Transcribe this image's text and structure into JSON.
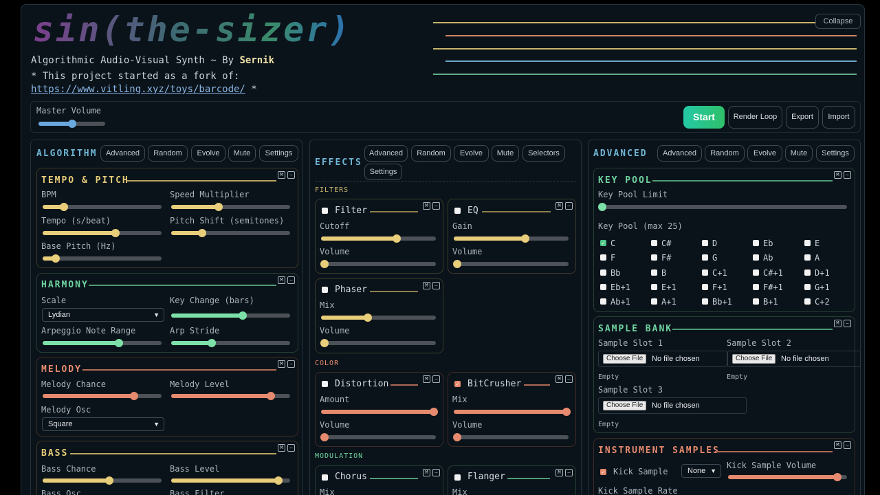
{
  "header": {
    "title": "sin(the-sizer)",
    "tagline": "Algorithmic Audio-Visual Synth ~ By ",
    "author": "Sernik",
    "fork_line": "* This project started as a fork of:",
    "fork_url": "https://www.vitling.xyz/toys/barcode/",
    "fork_suffix": " *",
    "collapse": "Collapse"
  },
  "visual_lines": [
    "#c8b56a",
    "#d08466",
    "#c8b56a",
    "#6fa6c8",
    "#5fb08a"
  ],
  "master": {
    "label": "Master Volume",
    "value": 0.5
  },
  "toolbar": {
    "start": "Start",
    "render_loop": "Render Loop",
    "export": "Export",
    "import": "Import"
  },
  "algorithm": {
    "title": "ALGORITHM",
    "buttons": [
      "Advanced",
      "Random",
      "Evolve",
      "Mute",
      "Settings"
    ],
    "tempo": {
      "title": "TEMPO & PITCH",
      "bpm": "BPM",
      "speed": "Speed Multiplier",
      "tempo": "Tempo (s/beat)",
      "pitch_shift": "Pitch Shift (semitones)",
      "base_pitch": "Base Pitch (Hz)",
      "values": {
        "bpm": 0.18,
        "speed": 0.4,
        "tempo": 0.61,
        "pitch_shift": 0.26,
        "base_pitch": 0.11
      }
    },
    "harmony": {
      "title": "HARMONY",
      "scale": "Scale",
      "scale_value": "Lydian",
      "key_change": "Key Change (bars)",
      "arp_range": "Arpeggio Note Range",
      "arp_stride": "Arp Stride",
      "values": {
        "key_change": 0.6,
        "arp_range": 0.64,
        "arp_stride": 0.34
      }
    },
    "melody": {
      "title": "MELODY",
      "chance": "Melody Chance",
      "level": "Melody Level",
      "osc": "Melody Osc",
      "osc_value": "Square",
      "values": {
        "chance": 0.77,
        "level": 0.84
      }
    },
    "bass": {
      "title": "BASS",
      "chance": "Bass Chance",
      "level": "Bass Level",
      "osc": "Bass Osc",
      "filter": "Bass Filter",
      "values": {
        "chance": 0.56,
        "level": 0.9
      }
    }
  },
  "effects": {
    "title": "EFFECTS",
    "buttons": [
      "Advanced",
      "Random",
      "Evolve",
      "Mute",
      "Selectors",
      "Settings"
    ],
    "filters_label": "FILTERS",
    "color_label": "COLOR",
    "mod_label": "MODULATION",
    "filter": {
      "name": "Filter",
      "p1": "Cutoff",
      "p2": "Volume",
      "values": [
        0.66,
        0.03
      ]
    },
    "eq": {
      "name": "EQ",
      "p1": "Gain",
      "p2": "Volume",
      "values": [
        0.62,
        0.03
      ]
    },
    "phaser": {
      "name": "Phaser",
      "p1": "Mix",
      "p2": "Volume",
      "values": [
        0.41,
        0.03
      ]
    },
    "distortion": {
      "name": "Distortion",
      "p1": "Amount",
      "p2": "Volume",
      "values": [
        0.98,
        0.03
      ]
    },
    "bitcrusher": {
      "name": "BitCrusher",
      "p1": "Mix",
      "p2": "Volume",
      "values": [
        0.98,
        0.03
      ]
    },
    "chorus": {
      "name": "Chorus",
      "p1": "Mix"
    },
    "flanger": {
      "name": "Flanger",
      "p1": "Mix"
    }
  },
  "advanced": {
    "title": "ADVANCED",
    "buttons": [
      "Advanced",
      "Random",
      "Evolve",
      "Mute",
      "Settings"
    ],
    "keypool": {
      "title": "KEY POOL",
      "limit": "Key Pool Limit",
      "limit_value": 0.01,
      "label": "Key Pool (max 25)",
      "keys": [
        "C",
        "C#",
        "D",
        "Eb",
        "E",
        "F",
        "F#",
        "G",
        "Ab",
        "A",
        "Bb",
        "B",
        "C+1",
        "C#+1",
        "D+1",
        "Eb+1",
        "E+1",
        "F+1",
        "F#+1",
        "G+1",
        "Ab+1",
        "A+1",
        "Bb+1",
        "B+1",
        "C+2"
      ]
    },
    "samplebank": {
      "title": "SAMPLE BANK",
      "slot1": "Sample Slot 1",
      "slot2": "Sample Slot 2",
      "slot3": "Sample Slot 3",
      "choose": "Choose File",
      "nofile": "No file chosen",
      "empty": "Empty"
    },
    "instrument": {
      "title": "INSTRUMENT SAMPLES",
      "kick": "Kick Sample",
      "kick_select": "None",
      "kick_volume": "Kick Sample Volume",
      "kick_volume_value": 0.92,
      "kick_rate": "Kick Sample Rate"
    }
  }
}
